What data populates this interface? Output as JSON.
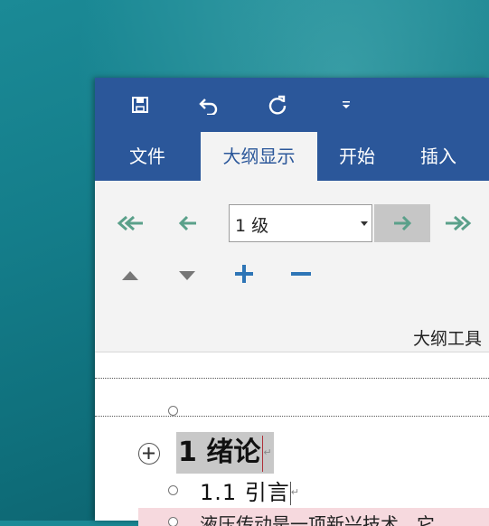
{
  "quick_access": {
    "save_icon": "save-icon",
    "undo_icon": "undo-icon",
    "redo_icon": "redo-icon",
    "customize_icon": "customize-dropdown-icon"
  },
  "tabs": [
    {
      "label": "文件",
      "active": false
    },
    {
      "label": "大纲显示",
      "active": true
    },
    {
      "label": "开始",
      "active": false
    },
    {
      "label": "插入",
      "active": false
    }
  ],
  "ribbon": {
    "level_value": "1 级",
    "group_label": "大纲工具",
    "accent_color": "#5aa08a"
  },
  "document": {
    "heading1": "1 绪论",
    "heading2": "1.1  引言",
    "body_text": "液压传动是一项新兴技术，它",
    "para_mark": "↵"
  },
  "colors": {
    "title_bar": "#2b579a",
    "ribbon_bg": "#f3f3f3",
    "highlight": "#f6d9de"
  }
}
